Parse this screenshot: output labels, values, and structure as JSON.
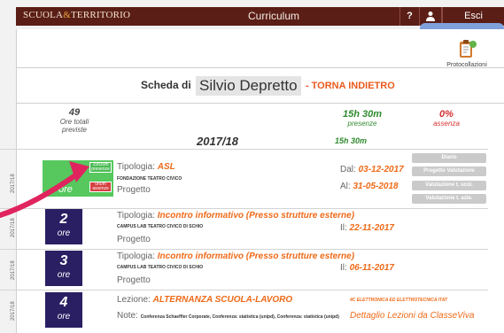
{
  "topbar": {
    "brand_prefix": "SCUOLA",
    "brand_amp": "&",
    "brand_suffix": "TERRITORIO",
    "title": "Curriculum",
    "help": "?",
    "user_icon": "user-icon",
    "logout": "Esci"
  },
  "protocollazioni": {
    "icon": "clipboard-icon",
    "label": "Protocollazioni"
  },
  "header": {
    "scheda_prefix": "Scheda di",
    "student_name": "Silvio Depretto",
    "back_link": "- TORNA INDIETRO"
  },
  "stats": {
    "total_hours": "49",
    "total_label": "Ore totali previste",
    "presence_hours": "15h 30m",
    "presence_label": "presenze",
    "absence_pct": "0%",
    "absence_label": "assenza"
  },
  "year_block": {
    "year": "2017/18",
    "hours": "15h 30m"
  },
  "records": [
    {
      "year": "2017/18",
      "tipologia_label": "Tipologia:",
      "tipologia": "ASL",
      "org": "FONDAZIONE TEATRO CIVICO",
      "progetto": "Progetto",
      "dal_label": "Dal:",
      "dal": "03-12-2017",
      "al_label": "Al:",
      "al": "31-05-2018",
      "ore_unit": "ore",
      "tag_green_top": "15h30m",
      "tag_green_bottom": "presenze",
      "tag_red_top": "0h0m",
      "tag_red_bottom": "assenze",
      "buttons": [
        "Diario",
        "Progetto Valutazioni",
        "Valutazione t. scol.",
        "Valutazione t. azie."
      ]
    },
    {
      "year": "2017/18",
      "ore": "2",
      "ore_unit": "ore",
      "tipologia_label": "Tipologia:",
      "tipologia": "Incontro informativo (Presso strutture esterne)",
      "org": "CAMPUS LAB TEATRO CIVICO DI SCHIO",
      "progetto": "Progetto",
      "il_label": "Il:",
      "il": "22-11-2017"
    },
    {
      "year": "2017/18",
      "ore": "3",
      "ore_unit": "ore",
      "tipologia_label": "Tipologia:",
      "tipologia": "Incontro informativo (Presso strutture esterne)",
      "org": "CAMPUS LAB TEATRO CIVICO DI SCHIO",
      "progetto": "Progetto",
      "il_label": "Il:",
      "il": "06-11-2017"
    },
    {
      "year": "2017/18",
      "ore": "4",
      "ore_unit": "ore",
      "lezione_label": "Lezione:",
      "lezione": "ALTERNANZA SCUOLA-LAVORO",
      "classe": "4C ELETTRONICA ED ELETTROTECNICA ITAT",
      "note_label": "Note:",
      "note": "Conferenza Schaeffler Corporate, Conferenza: statistica (unipd), Conferenza: statistica (unipd)",
      "dettaglio": "Dettaglio Lezioni da ClasseViva"
    }
  ],
  "colors": {
    "topbar": "#5a1e16",
    "accent_orange": "#ee6a18",
    "ore_box": "#2a1f63",
    "green": "#56c85e",
    "red": "#d64040",
    "arrow": "#e0245e",
    "pill": "#7fa1dc"
  }
}
